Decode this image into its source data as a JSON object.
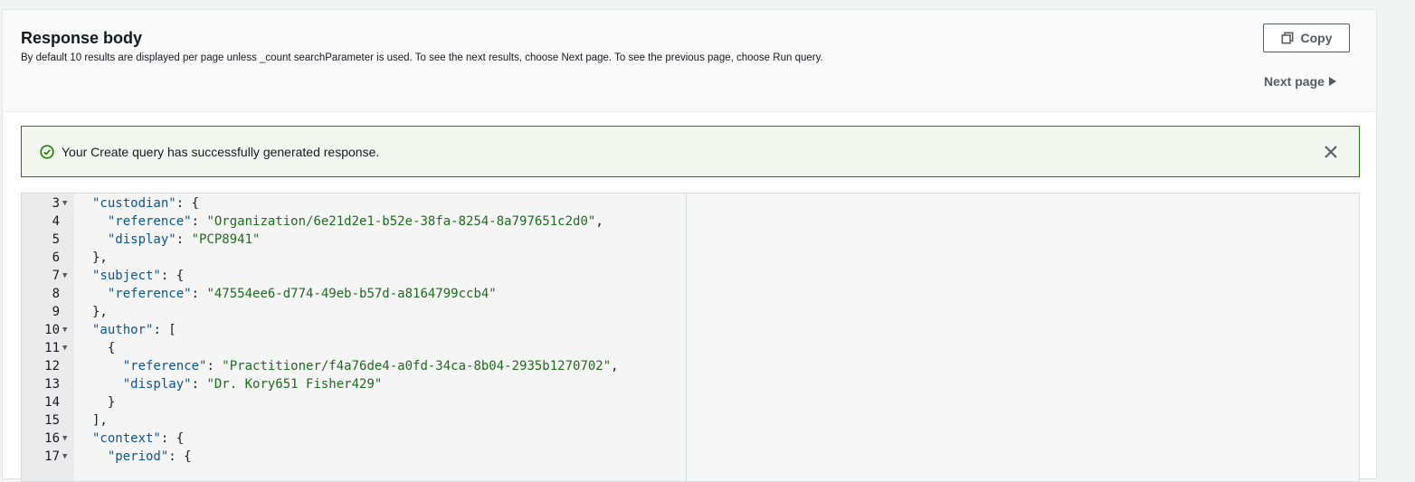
{
  "header": {
    "title": "Response body",
    "description": "By default 10 results are displayed per page unless _count searchParameter is used. To see the next results, choose Next page. To see the previous page, choose Run query.",
    "copy_label": "Copy",
    "next_page_label": "Next page"
  },
  "alert": {
    "message": "Your Create query has successfully generated response.",
    "icon": "check-circle-icon",
    "close_icon": "close-icon"
  },
  "colors": {
    "success": "#1d8102",
    "alert_bg": "#f2f8f0",
    "string": "#1d6b1d",
    "key": "#0b5394"
  },
  "code": {
    "lines": [
      {
        "num": "3",
        "fold": true,
        "indent": 2,
        "parts": [
          {
            "t": "k",
            "v": "\"custodian\""
          },
          {
            "t": "p",
            "v": ": {"
          }
        ]
      },
      {
        "num": "4",
        "fold": false,
        "indent": 4,
        "parts": [
          {
            "t": "k",
            "v": "\"reference\""
          },
          {
            "t": "p",
            "v": ": "
          },
          {
            "t": "s",
            "v": "\"Organization/6e21d2e1-b52e-38fa-8254-8a797651c2d0\""
          },
          {
            "t": "p",
            "v": ","
          }
        ]
      },
      {
        "num": "5",
        "fold": false,
        "indent": 4,
        "parts": [
          {
            "t": "k",
            "v": "\"display\""
          },
          {
            "t": "p",
            "v": ": "
          },
          {
            "t": "s",
            "v": "\"PCP8941\""
          }
        ]
      },
      {
        "num": "6",
        "fold": false,
        "indent": 2,
        "parts": [
          {
            "t": "p",
            "v": "},"
          }
        ]
      },
      {
        "num": "7",
        "fold": true,
        "indent": 2,
        "parts": [
          {
            "t": "k",
            "v": "\"subject\""
          },
          {
            "t": "p",
            "v": ": {"
          }
        ]
      },
      {
        "num": "8",
        "fold": false,
        "indent": 4,
        "parts": [
          {
            "t": "k",
            "v": "\"reference\""
          },
          {
            "t": "p",
            "v": ": "
          },
          {
            "t": "s",
            "v": "\"47554ee6-d774-49eb-b57d-a8164799ccb4\""
          }
        ]
      },
      {
        "num": "9",
        "fold": false,
        "indent": 2,
        "parts": [
          {
            "t": "p",
            "v": "},"
          }
        ]
      },
      {
        "num": "10",
        "fold": true,
        "indent": 2,
        "parts": [
          {
            "t": "k",
            "v": "\"author\""
          },
          {
            "t": "p",
            "v": ": ["
          }
        ]
      },
      {
        "num": "11",
        "fold": true,
        "indent": 4,
        "parts": [
          {
            "t": "p",
            "v": "{"
          }
        ]
      },
      {
        "num": "12",
        "fold": false,
        "indent": 6,
        "parts": [
          {
            "t": "k",
            "v": "\"reference\""
          },
          {
            "t": "p",
            "v": ": "
          },
          {
            "t": "s",
            "v": "\"Practitioner/f4a76de4-a0fd-34ca-8b04-2935b1270702\""
          },
          {
            "t": "p",
            "v": ","
          }
        ]
      },
      {
        "num": "13",
        "fold": false,
        "indent": 6,
        "parts": [
          {
            "t": "k",
            "v": "\"display\""
          },
          {
            "t": "p",
            "v": ": "
          },
          {
            "t": "s",
            "v": "\"Dr. Kory651 Fisher429\""
          }
        ]
      },
      {
        "num": "14",
        "fold": false,
        "indent": 4,
        "parts": [
          {
            "t": "p",
            "v": "}"
          }
        ]
      },
      {
        "num": "15",
        "fold": false,
        "indent": 2,
        "parts": [
          {
            "t": "p",
            "v": "],"
          }
        ]
      },
      {
        "num": "16",
        "fold": true,
        "indent": 2,
        "parts": [
          {
            "t": "k",
            "v": "\"context\""
          },
          {
            "t": "p",
            "v": ": {"
          }
        ]
      },
      {
        "num": "17",
        "fold": true,
        "indent": 4,
        "parts": [
          {
            "t": "k",
            "v": "\"period\""
          },
          {
            "t": "p",
            "v": ": {"
          }
        ]
      }
    ]
  }
}
